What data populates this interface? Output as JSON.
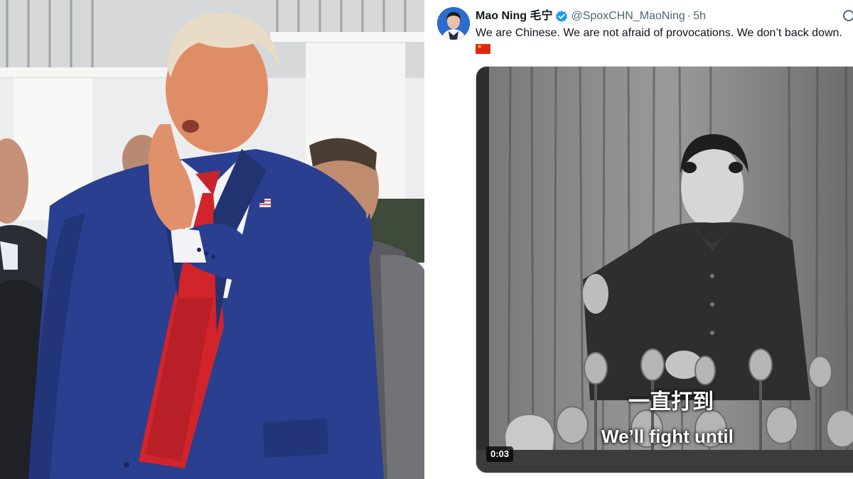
{
  "tweet": {
    "display_name": "Mao Ning 毛宁",
    "handle": "@SpoxCHN_MaoNing",
    "separator": "·",
    "time": "5h",
    "text": "We are Chinese. We are not afraid of provocations. We don’t back down.",
    "flag_emoji": "china-flag-icon"
  },
  "video": {
    "subtitle_cn": "一直打到",
    "subtitle_en": "We’ll fight until",
    "duration": "0:03"
  },
  "colors": {
    "text_primary": "#0f1419",
    "text_secondary": "#536471",
    "verified_blue": "#1d9bf0",
    "flag_red": "#de2910",
    "flag_yellow": "#ffde00",
    "suit_blue": "#2a3f8f",
    "tie_red": "#d1242b"
  }
}
